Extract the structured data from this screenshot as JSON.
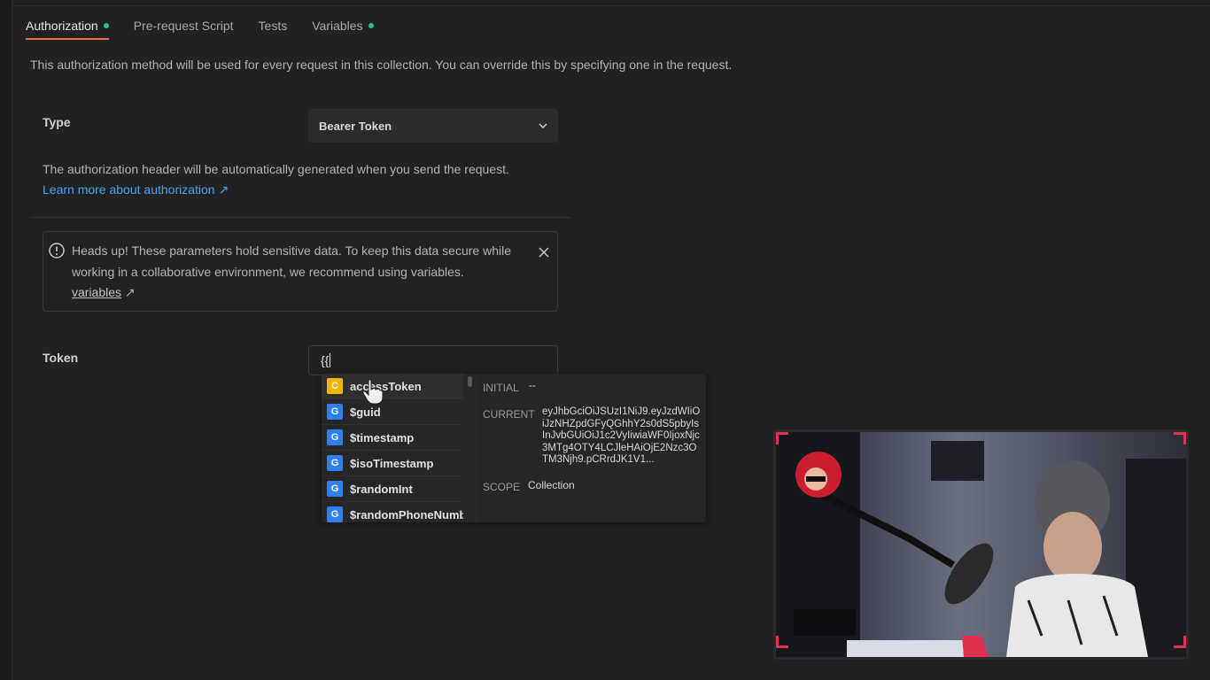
{
  "tabs": [
    {
      "label": "Authorization",
      "active": true,
      "has_dot": true
    },
    {
      "label": "Pre-request Script",
      "active": false,
      "has_dot": false
    },
    {
      "label": "Tests",
      "active": false,
      "has_dot": false
    },
    {
      "label": "Variables",
      "active": false,
      "has_dot": true
    }
  ],
  "description": "This authorization method will be used for every request in this collection. You can override this by specifying one in the request.",
  "type_section": {
    "label": "Type",
    "selected": "Bearer Token",
    "helper": "The authorization header will be automatically generated when you send the request.",
    "learn_more": "Learn more about authorization ↗"
  },
  "alert": {
    "text": "Heads up! These parameters hold sensitive data. To keep this data secure while working in a collaborative environment, we recommend using variables.",
    "link": "variables",
    "link_arrow": "↗"
  },
  "token": {
    "label": "Token",
    "value": "{{"
  },
  "autocomplete": {
    "items": [
      {
        "badge": "C",
        "name": "accessToken",
        "selected": true
      },
      {
        "badge": "G",
        "name": "$guid",
        "selected": false
      },
      {
        "badge": "G",
        "name": "$timestamp",
        "selected": false
      },
      {
        "badge": "G",
        "name": "$isoTimestamp",
        "selected": false
      },
      {
        "badge": "G",
        "name": "$randomInt",
        "selected": false
      },
      {
        "badge": "G",
        "name": "$randomPhoneNumb",
        "selected": false
      }
    ],
    "detail": {
      "initial_label": "INITIAL",
      "initial_value": "--",
      "current_label": "CURRENT",
      "current_value": "eyJhbGciOiJSUzI1NiJ9.eyJzdWIiOiJzNHZpdGFyQGhhY2s0dS5pbyIsInJvbGUiOiJ1c2VyIiwiaWF0IjoxNjc3MTg4OTY4LCJleHAiOjE2Nzc3OTM3Njh9.pCRrdJK1V1...",
      "scope_label": "SCOPE",
      "scope_value": "Collection"
    }
  },
  "colors": {
    "accent": "#ff6c37",
    "dot": "#2ec27e",
    "link": "#4aa1f0",
    "badge_collection": "#f4b400",
    "badge_global": "#2f7ff0"
  }
}
